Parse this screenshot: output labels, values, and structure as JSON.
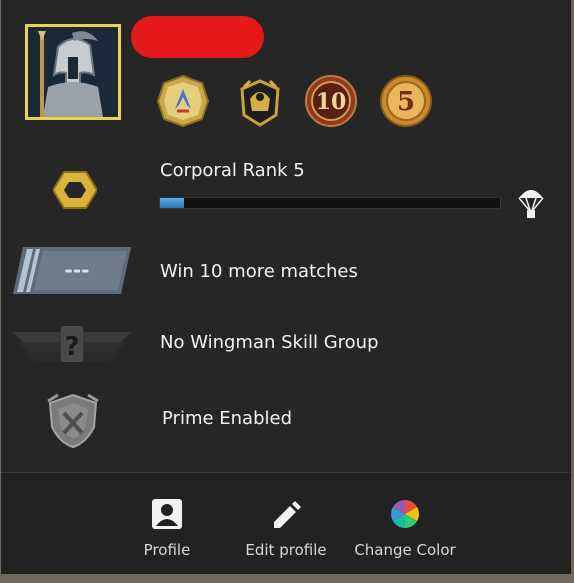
{
  "profile": {
    "avatar_icon": "spartan-helmet-avatar",
    "name_redacted": true
  },
  "coins": [
    {
      "icon": "operation-coin-gold-blue"
    },
    {
      "icon": "counter-strike-gold-trophy-coin"
    },
    {
      "icon": "10-year-veteran-coin"
    },
    {
      "icon": "5-year-veteran-coin"
    }
  ],
  "rank": {
    "title": "Corporal Rank 5",
    "xp_progress": 0.07,
    "icon": "corporal-chevron-icon",
    "reward_icon": "parachute-icon"
  },
  "competitive": {
    "label": "Win 10 more matches",
    "badge_text": "---",
    "icon": "unranked-competitive-icon"
  },
  "wingman": {
    "label": "No Wingman Skill Group",
    "icon": "wingman-unknown-icon"
  },
  "prime": {
    "label": "Prime Enabled",
    "icon": "prime-shield-icon"
  },
  "actions": [
    {
      "label": "Profile",
      "icon": "person-icon"
    },
    {
      "label": "Edit profile",
      "icon": "pencil-icon"
    },
    {
      "label": "Change Color",
      "icon": "color-wheel-icon"
    }
  ],
  "colors": {
    "panel_bg": "#262626",
    "avatar_border": "#e9d44c",
    "xp_fill": "#3b8fd0",
    "text": "#f1f1f1"
  }
}
